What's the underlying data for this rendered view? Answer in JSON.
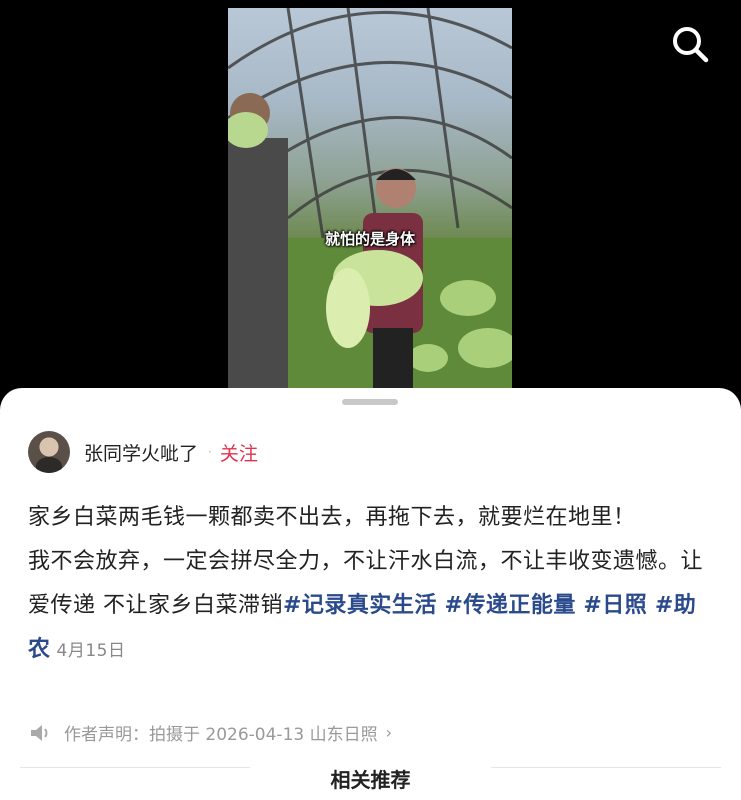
{
  "video": {
    "subtitle": "就怕的是身体"
  },
  "icons": {
    "search": "search-icon",
    "declaration": "speaker-icon",
    "chevron": "chevron-right-icon"
  },
  "author": {
    "name": "张同学火呲了",
    "dot": "·",
    "follow_label": "关注"
  },
  "description": {
    "line1": "家乡白菜两毛钱一颗都卖不出去，再拖下去，就要烂在地里！",
    "line2_text": "我不会放弃，一定会拼尽全力，不让汗水白流，不让丰收变遗憾。让爱传递 不让家乡白菜滞销",
    "tags": [
      "#记录真实生活",
      "#传递正能量",
      "#日照",
      "#助农"
    ],
    "date": "4月15日"
  },
  "declaration": {
    "text": "作者声明：拍摄于 2026-04-13 山东日照",
    "chevron": "›"
  },
  "related_title": "相关推荐",
  "colors": {
    "tag": "#2a4a8c",
    "follow": "#e0334e",
    "background": "#000000",
    "sheet": "#ffffff"
  }
}
